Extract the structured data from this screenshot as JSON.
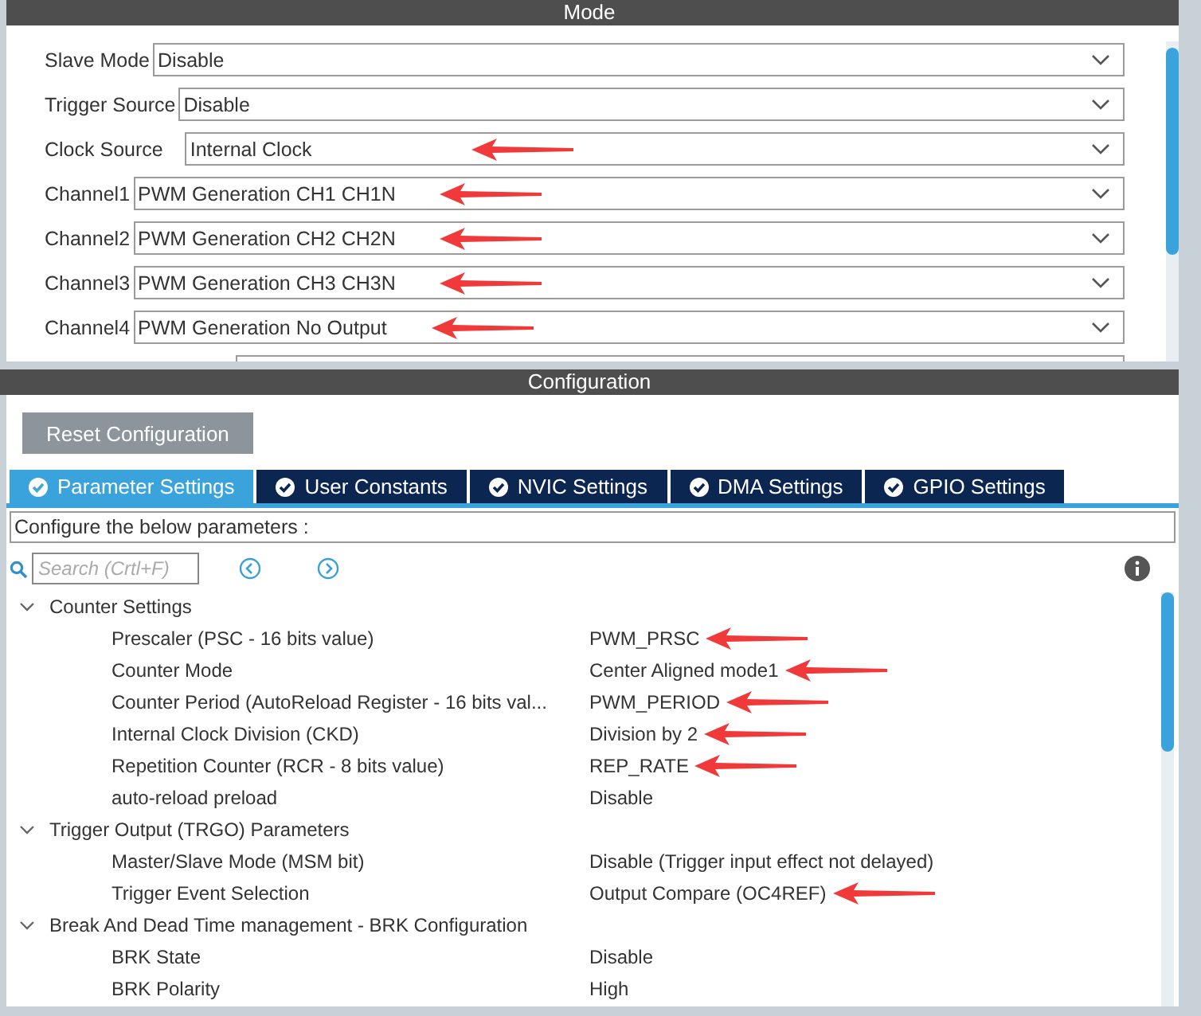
{
  "mode_panel": {
    "title": "Mode",
    "rows": [
      {
        "label": "Slave Mode",
        "value": "Disable",
        "marked": false
      },
      {
        "label": "Trigger Source",
        "value": "Disable",
        "marked": false
      },
      {
        "label": "Clock Source",
        "value": "Internal Clock",
        "marked": true
      },
      {
        "label": "Channel1",
        "value": "PWM Generation CH1 CH1N",
        "marked": true
      },
      {
        "label": "Channel2",
        "value": "PWM Generation CH2 CH2N",
        "marked": true
      },
      {
        "label": "Channel3",
        "value": "PWM Generation CH3 CH3N",
        "marked": true
      },
      {
        "label": "Channel4",
        "value": "PWM Generation No Output",
        "marked": true
      }
    ]
  },
  "configuration": {
    "title": "Configuration",
    "reset_button": "Reset Configuration",
    "tabs": [
      {
        "label": "Parameter Settings",
        "selected": true
      },
      {
        "label": "User Constants",
        "selected": false
      },
      {
        "label": "NVIC Settings",
        "selected": false
      },
      {
        "label": "DMA Settings",
        "selected": false
      },
      {
        "label": "GPIO Settings",
        "selected": false
      }
    ],
    "description": "Configure the below parameters :",
    "search": {
      "placeholder": "Search (Crtl+F)"
    },
    "groups": [
      {
        "label": "Counter Settings",
        "expanded": true,
        "children": [
          {
            "name": "Prescaler (PSC - 16 bits value)",
            "value": "PWM_PRSC",
            "marked": true
          },
          {
            "name": "Counter Mode",
            "value": "Center Aligned mode1",
            "marked": true
          },
          {
            "name": "Counter Period (AutoReload Register - 16 bits val...",
            "value": "PWM_PERIOD",
            "marked": true
          },
          {
            "name": "Internal Clock Division (CKD)",
            "value": "Division by 2",
            "marked": true
          },
          {
            "name": "Repetition Counter (RCR - 8 bits value)",
            "value": "REP_RATE",
            "marked": true
          },
          {
            "name": "auto-reload preload",
            "value": "Disable",
            "marked": false
          }
        ]
      },
      {
        "label": "Trigger Output (TRGO) Parameters",
        "expanded": true,
        "children": [
          {
            "name": "Master/Slave Mode (MSM bit)",
            "value": "Disable (Trigger input effect not delayed)",
            "marked": false
          },
          {
            "name": "Trigger Event Selection",
            "value": "Output Compare (OC4REF)",
            "marked": true
          }
        ]
      },
      {
        "label": "Break And Dead Time management - BRK Configuration",
        "expanded": true,
        "children": [
          {
            "name": "BRK State",
            "value": "Disable",
            "marked": false
          },
          {
            "name": "BRK Polarity",
            "value": "High",
            "marked": false
          }
        ]
      }
    ]
  }
}
